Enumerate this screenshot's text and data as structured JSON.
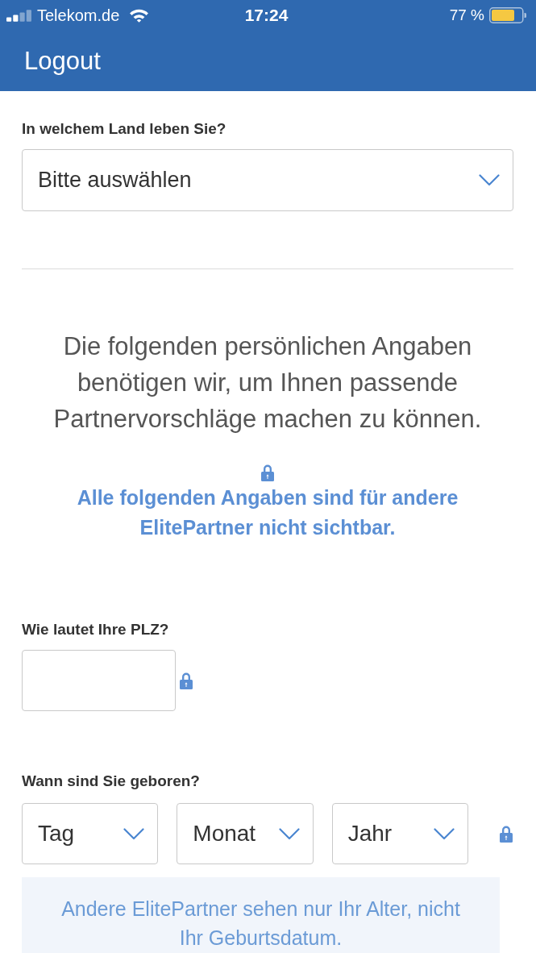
{
  "status_bar": {
    "carrier": "Telekom.de",
    "time": "17:24",
    "battery_percent": "77 %"
  },
  "nav_bar": {
    "button": "Logout"
  },
  "country": {
    "label": "In welchem Land leben Sie?",
    "select": {
      "placeholder": "Bitte auswählen"
    }
  },
  "intro": {
    "text": "Die folgenden persönlichen Angaben benötigen wir, um Ihnen passende Partnervorschläge machen zu können.",
    "privacy_note": "Alle folgenden Angaben sind für andere ElitePartner nicht sichtbar."
  },
  "postal_code": {
    "label": "Wie lautet Ihre PLZ?"
  },
  "birth_date": {
    "label": "Wann sind Sie geboren?",
    "selects": [
      {
        "placeholder": "Tag"
      },
      {
        "placeholder": "Monat"
      },
      {
        "placeholder": "Jahr"
      }
    ],
    "note": "Andere ElitePartner sehen nur Ihr Alter, nicht Ihr Geburtsdatum."
  }
}
